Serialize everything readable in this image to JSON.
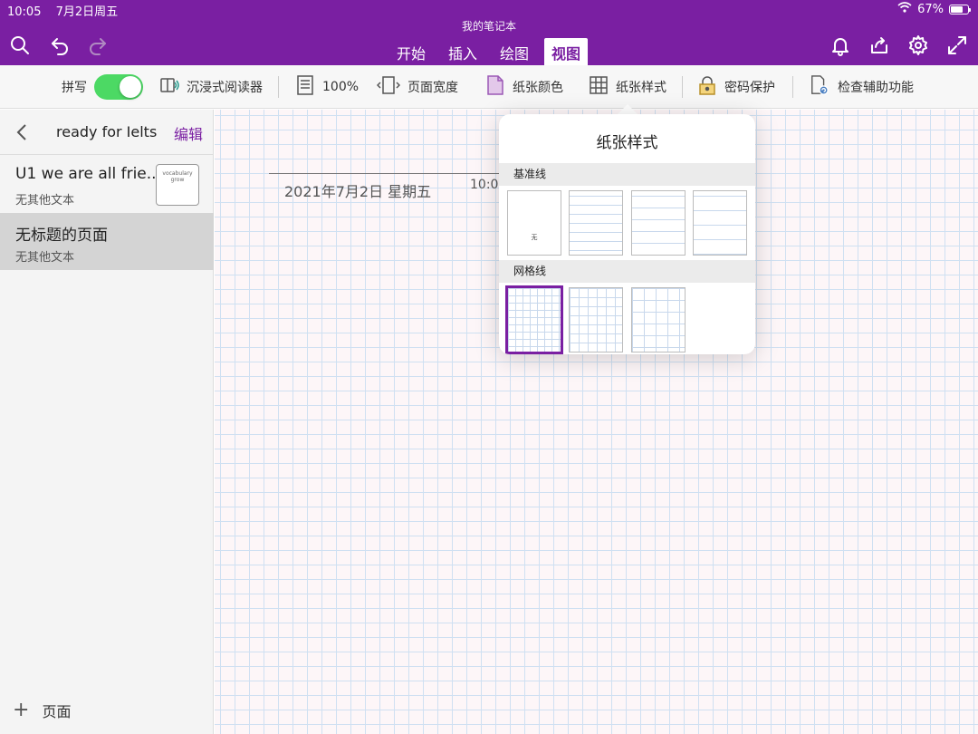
{
  "status": {
    "time": "10:05",
    "date": "7月2日周五",
    "battery": "67%",
    "battery_level": 0.67
  },
  "notebook_title": "我的笔记本",
  "tabs": [
    {
      "label": "开始",
      "active": false
    },
    {
      "label": "插入",
      "active": false
    },
    {
      "label": "绘图",
      "active": false
    },
    {
      "label": "视图",
      "active": true
    }
  ],
  "ribbon": {
    "spellcheck_label": "拼写",
    "spellcheck_on": true,
    "immersive_reader": "沉浸式阅读器",
    "zoom": "100%",
    "page_width": "页面宽度",
    "paper_color": "纸张颜色",
    "paper_style": "纸张样式",
    "password": "密码保护",
    "accessibility": "检查辅助功能"
  },
  "sidebar": {
    "section_title": "ready for Ielts",
    "edit_label": "编辑",
    "pages": [
      {
        "title": "U1 we are all frie...",
        "subtitle": "无其他文本",
        "thumb_text": "vocabulary grow"
      },
      {
        "title": "无标题的页面",
        "subtitle": "无其他文本",
        "selected": true
      }
    ],
    "add_page_label": "页面"
  },
  "canvas": {
    "date": "2021年7月2日 星期五",
    "time": "10:0"
  },
  "popover": {
    "title": "纸张样式",
    "rule_lines_header": "基准线",
    "grid_lines_header": "网格线",
    "none_label": "无"
  },
  "colors": {
    "accent": "#7a1fa2",
    "toggle_on": "#4cd964",
    "grid_line": "#cfe0f2",
    "paper": "#fdf6f8"
  }
}
